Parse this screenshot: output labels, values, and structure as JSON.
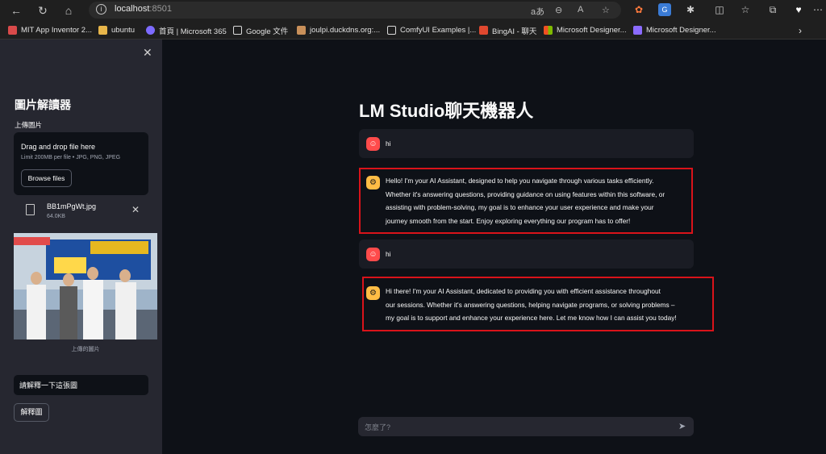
{
  "browser": {
    "url_host": "localhost",
    "url_port": ":8501",
    "bookmarks": [
      {
        "label": "MIT App Inventor 2...",
        "color": "#d94a4a"
      },
      {
        "label": "ubuntu",
        "color": "#e8b64a"
      },
      {
        "label": "首頁 | Microsoft 365",
        "color": "#7d6bff"
      },
      {
        "label": "Google 文件",
        "color": "#dadada"
      },
      {
        "label": "joulpi.duckdns.org:...",
        "color": "#c9905a"
      },
      {
        "label": "ComfyUI Examples |...",
        "color": "#dadada"
      },
      {
        "label": "BingAI - 聊天",
        "color": "#e0482f"
      },
      {
        "label": "Microsoft Designer...",
        "color": "#4aa3e8"
      },
      {
        "label": "Microsoft Designer...",
        "color": "#8b6bff"
      }
    ]
  },
  "sidebar": {
    "title": "圖片解讀器",
    "upload_label": "上傳圖片",
    "dropzone_title": "Drag and drop file here",
    "dropzone_limit": "Limit 200MB per file • JPG, PNG, JPEG",
    "browse_label": "Browse files",
    "file_name": "BB1mPgWt.jpg",
    "file_size": "64.0KB",
    "image_caption": "上傳的圖片",
    "prompt_value": "請解釋一下這張圖",
    "explain_label": "解釋圖"
  },
  "main": {
    "title": "LM Studio聊天機器人",
    "messages": [
      {
        "role": "user",
        "lines": [
          "hi"
        ]
      },
      {
        "role": "assistant",
        "lines": [
          "Hello! I'm your AI Assistant, designed to help you navigate through various tasks efficiently.",
          "Whether it's answering questions, providing guidance on using features within this software, or",
          "assisting with problem-solving, my goal is to enhance your user experience and make your",
          "journey smooth from the start. Enjoy exploring everything our program has to offer!"
        ]
      },
      {
        "role": "user",
        "lines": [
          "hi"
        ]
      },
      {
        "role": "assistant",
        "lines": [
          "Hi there! I'm your AI Assistant, dedicated to providing you with efficient assistance throughout",
          "our sessions. Whether it's answering questions, helping navigate programs, or solving problems –",
          "my goal is to support and enhance your experience here. Let me know how I can assist you today!"
        ]
      }
    ],
    "chat_placeholder": "怎麼了?"
  },
  "colors": {
    "highlight": "#d9131a",
    "user_avatar": "#ff4b4b",
    "bot_avatar": "#ffbd45"
  }
}
